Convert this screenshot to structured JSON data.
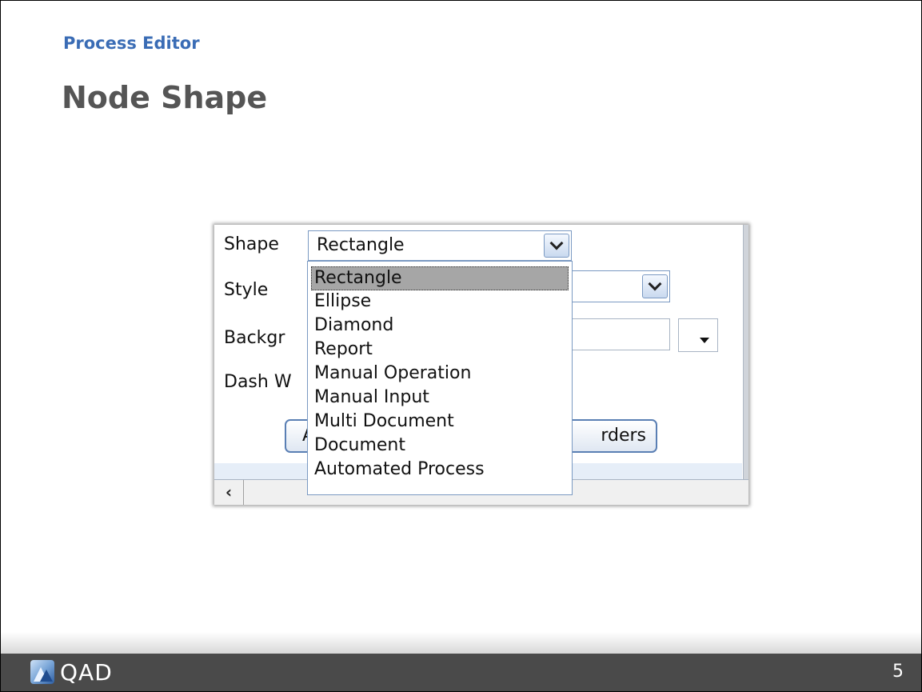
{
  "slide": {
    "section_title": "Process Editor",
    "heading": "Node Shape"
  },
  "form": {
    "shape_label": "Shape",
    "shape_value": "Rectangle",
    "style_label": "Style",
    "background_label_partial": "Backgr",
    "dash_label_partial": "Dash W",
    "apply_button_partial": "A",
    "borders_button_partial": "rders"
  },
  "dropdown": {
    "options": [
      {
        "label": "Rectangle",
        "selected": true
      },
      {
        "label": "Ellipse"
      },
      {
        "label": "Diamond"
      },
      {
        "label": "Report"
      },
      {
        "label": "Manual Operation"
      },
      {
        "label": "Manual Input"
      },
      {
        "label": "Multi Document"
      },
      {
        "label": "Document"
      },
      {
        "label": "Automated Process"
      }
    ]
  },
  "footer": {
    "logo_text": "QAD",
    "page_number": "5"
  },
  "colors": {
    "section_title": "#3a6cb5",
    "heading": "#555555",
    "footer_bg": "#4a4a4a",
    "selected_option_bg": "#a6a6a6"
  }
}
